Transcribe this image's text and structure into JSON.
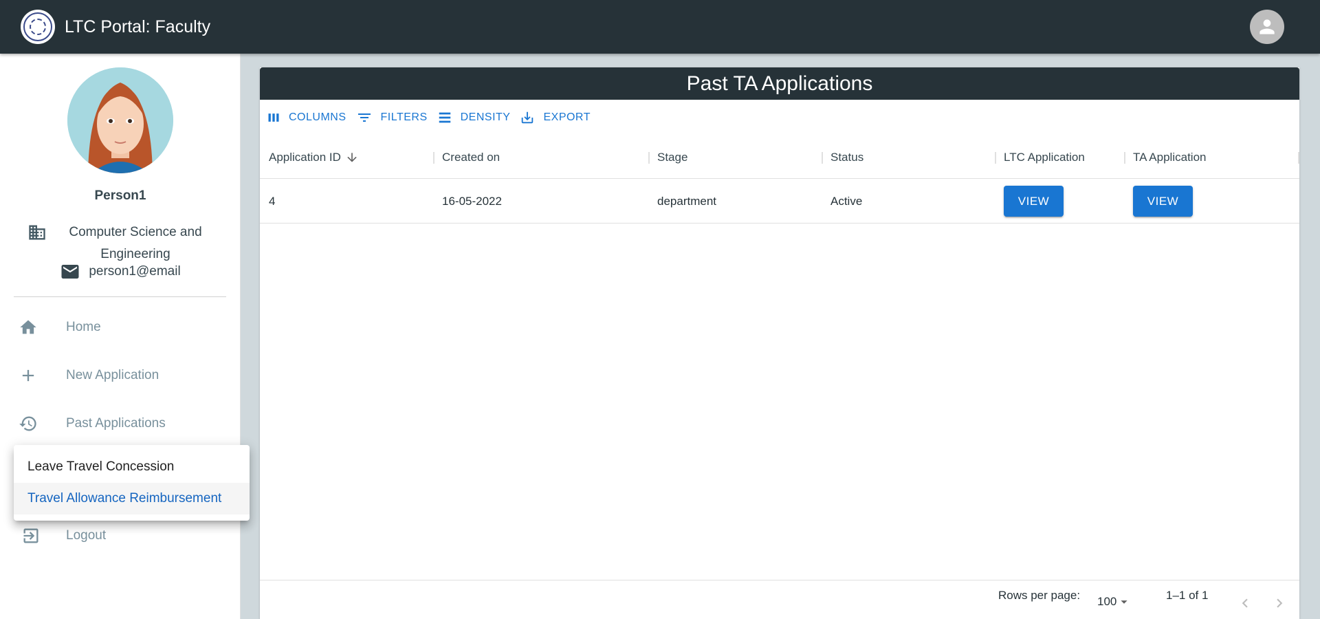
{
  "app": {
    "title": "LTC Portal: Faculty"
  },
  "profile": {
    "name": "Person1",
    "department": "Computer Science and Engineering",
    "email": "person1@email"
  },
  "nav": {
    "items": [
      {
        "label": "Home",
        "icon": "home-icon"
      },
      {
        "label": "New Application",
        "icon": "plus-icon"
      },
      {
        "label": "Past Applications",
        "icon": "history-icon"
      },
      {
        "label": "Logout",
        "icon": "logout-icon"
      }
    ]
  },
  "menu": {
    "items": [
      {
        "label": "Leave Travel Concession",
        "selected": false
      },
      {
        "label": "Travel Allowance Reimbursement",
        "selected": true
      }
    ]
  },
  "card": {
    "title": "Past TA Applications",
    "toolbar": {
      "columns": "COLUMNS",
      "filters": "FILTERS",
      "density": "DENSITY",
      "export": "EXPORT"
    },
    "columns": [
      "Application ID",
      "Created on",
      "Stage",
      "Status",
      "LTC Application",
      "TA Application"
    ],
    "rows": [
      {
        "id": "4",
        "created": "16-05-2022",
        "stage": "department",
        "status": "Active",
        "ltc_button": "VIEW",
        "ta_button": "VIEW"
      }
    ],
    "footer": {
      "rows_per_page_label": "Rows per page:",
      "rows_per_page_value": "100",
      "page_info": "1–1 of 1"
    }
  },
  "colors": {
    "appbar": "#263238",
    "accent": "#1976d2",
    "background": "#cfd8dc"
  }
}
